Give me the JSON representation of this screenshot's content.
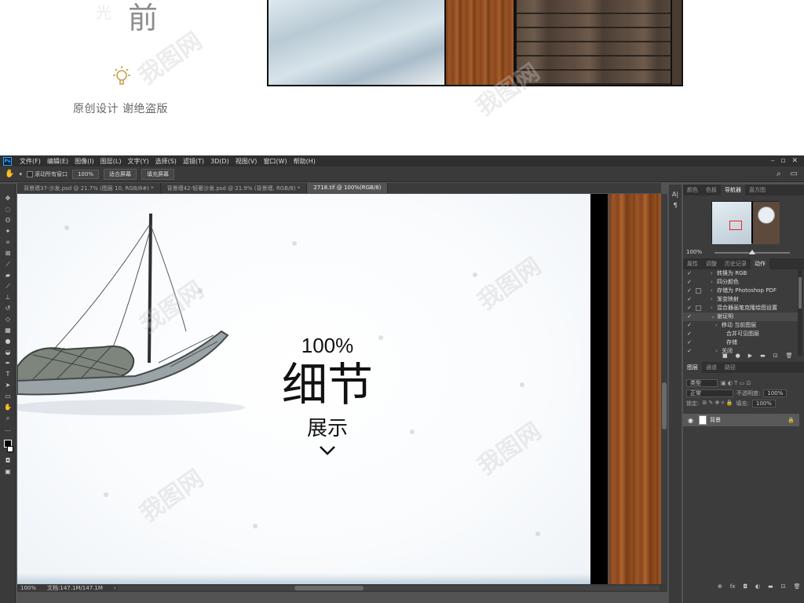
{
  "promo": {
    "faint_char": "光",
    "big_char": "前",
    "caption": "原创设计  谢绝盗版",
    "dashes": "_ _ _ _ _ _ _ _ _ _ _ _ _ _ _ _ _ _ _ _ _ _ _ _ _ _ _ _ _ _ _ _ _ _ _ _ _ _ _ _ _ _ _ _ _ _ _ _ _ _ _ _ _ _ _ _ _ _ _ _ _ _ _"
  },
  "watermark_text": "我图网",
  "ps": {
    "logo": "Ps",
    "menu": [
      "文件(F)",
      "编辑(E)",
      "图像(I)",
      "图层(L)",
      "文字(Y)",
      "选择(S)",
      "滤镜(T)",
      "3D(D)",
      "视图(V)",
      "窗口(W)",
      "帮助(H)"
    ],
    "window_controls": [
      "–",
      "▫",
      "✕"
    ],
    "options": {
      "scroll_all_label": "滚动所有窗口",
      "zoom_value": "100%",
      "fit_screen": "适合屏幕",
      "fill_screen": "填充屏幕"
    },
    "tabs": [
      {
        "label": "背景墙37-沙发.psd @ 21.7% (图层 10, RGB/8#) *",
        "active": false
      },
      {
        "label": "背景墙42-轻奢沙发.psd @ 21.9% (背景墙, RGB/8) *",
        "active": false
      },
      {
        "label": "2718.tif @ 100%(RGB/8)",
        "active": true
      }
    ],
    "canvas": {
      "pct": "100%",
      "title": "细节",
      "subtitle": "展示"
    },
    "status": {
      "zoom": "100%",
      "doc": "文档:147.1M/147.1M"
    },
    "panel_tabs_1": [
      "颜色",
      "色板",
      "导航器",
      "直方图"
    ],
    "navigator_zoom": "100%",
    "panel_tabs_2": [
      "属性",
      "调整",
      "历史记录",
      "动作"
    ],
    "actions": [
      {
        "label": "转换为 RGB",
        "check": true,
        "box": false,
        "arrow": "›",
        "indent": 1,
        "sel": false
      },
      {
        "label": "四分颜色",
        "check": true,
        "box": false,
        "arrow": "›",
        "indent": 1,
        "sel": false
      },
      {
        "label": "存储为 Photoshop PDF",
        "check": true,
        "box": true,
        "arrow": "›",
        "indent": 1,
        "sel": false
      },
      {
        "label": "渐变映射",
        "check": true,
        "box": false,
        "arrow": "›",
        "indent": 1,
        "sel": false
      },
      {
        "label": "混合器画笔克隆绘图设置",
        "check": true,
        "box": true,
        "arrow": "›",
        "indent": 1,
        "sel": false
      },
      {
        "label": "谢证明",
        "check": true,
        "box": false,
        "arrow": "⌄",
        "indent": 1,
        "sel": true
      },
      {
        "label": "移动 当前图层",
        "check": true,
        "box": false,
        "arrow": "›",
        "indent": 2,
        "sel": false
      },
      {
        "label": "合并可见图层",
        "check": true,
        "box": false,
        "arrow": "",
        "indent": 3,
        "sel": false
      },
      {
        "label": "存储",
        "check": true,
        "box": false,
        "arrow": "",
        "indent": 3,
        "sel": false
      },
      {
        "label": "关闭",
        "check": true,
        "box": false,
        "arrow": "›",
        "indent": 2,
        "sel": false
      }
    ],
    "action_buttons": [
      "■",
      "●",
      "▶",
      "▬",
      "⊡",
      "🗑"
    ],
    "panel_tabs_3": [
      "图层",
      "通道",
      "路径"
    ],
    "layers": {
      "kind_label": "类型",
      "blend": "正常",
      "opacity_label": "不透明度:",
      "opacity": "100%",
      "lock_label": "锁定:",
      "fill_label": "填充:",
      "fill": "100%",
      "layer_name": "背景"
    },
    "layer_buttons": [
      "⊕",
      "fx",
      "◘",
      "◐",
      "▬",
      "⊡",
      "🗑"
    ]
  }
}
